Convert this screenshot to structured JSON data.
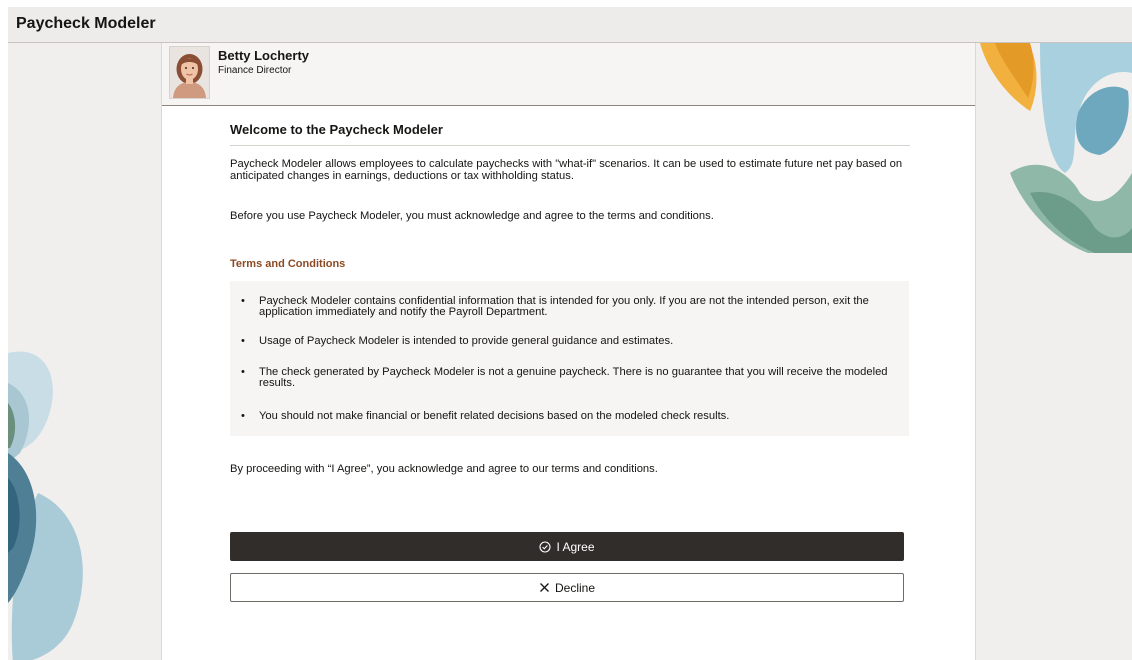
{
  "app": {
    "title": "Paycheck Modeler"
  },
  "profile": {
    "name": "Betty Locherty",
    "title": "Finance Director"
  },
  "main": {
    "welcome_title": "Welcome to the Paycheck Modeler",
    "intro": "Paycheck Modeler allows employees to calculate paychecks with \"what-if\" scenarios. It can be used to estimate future net pay based on anticipated changes in earnings, deductions or tax withholding status.",
    "before_text": "Before you use Paycheck Modeler, you must acknowledge and agree to the terms and conditions.",
    "terms_heading": "Terms and Conditions",
    "terms": [
      "Paycheck Modeler contains confidential information that is intended for you only. If you are not the intended person, exit the application immediately and notify the Payroll Department.",
      "Usage of Paycheck Modeler is intended to provide general guidance and estimates.",
      "The check generated by Paycheck Modeler is not a genuine paycheck. There is no guarantee that you will receive the modeled results.",
      "You should not make financial or benefit related decisions based on the modeled check results."
    ],
    "proceed_text": "By proceeding with “I Agree”, you acknowledge and agree to our terms and conditions.",
    "agree_label": "I Agree",
    "decline_label": "Decline"
  },
  "icons": {
    "agree": "check-circle-icon",
    "decline": "close-icon"
  },
  "colors": {
    "agree_button": "#312d2a",
    "terms_heading": "#8c4a24",
    "background": "#f1efed"
  }
}
